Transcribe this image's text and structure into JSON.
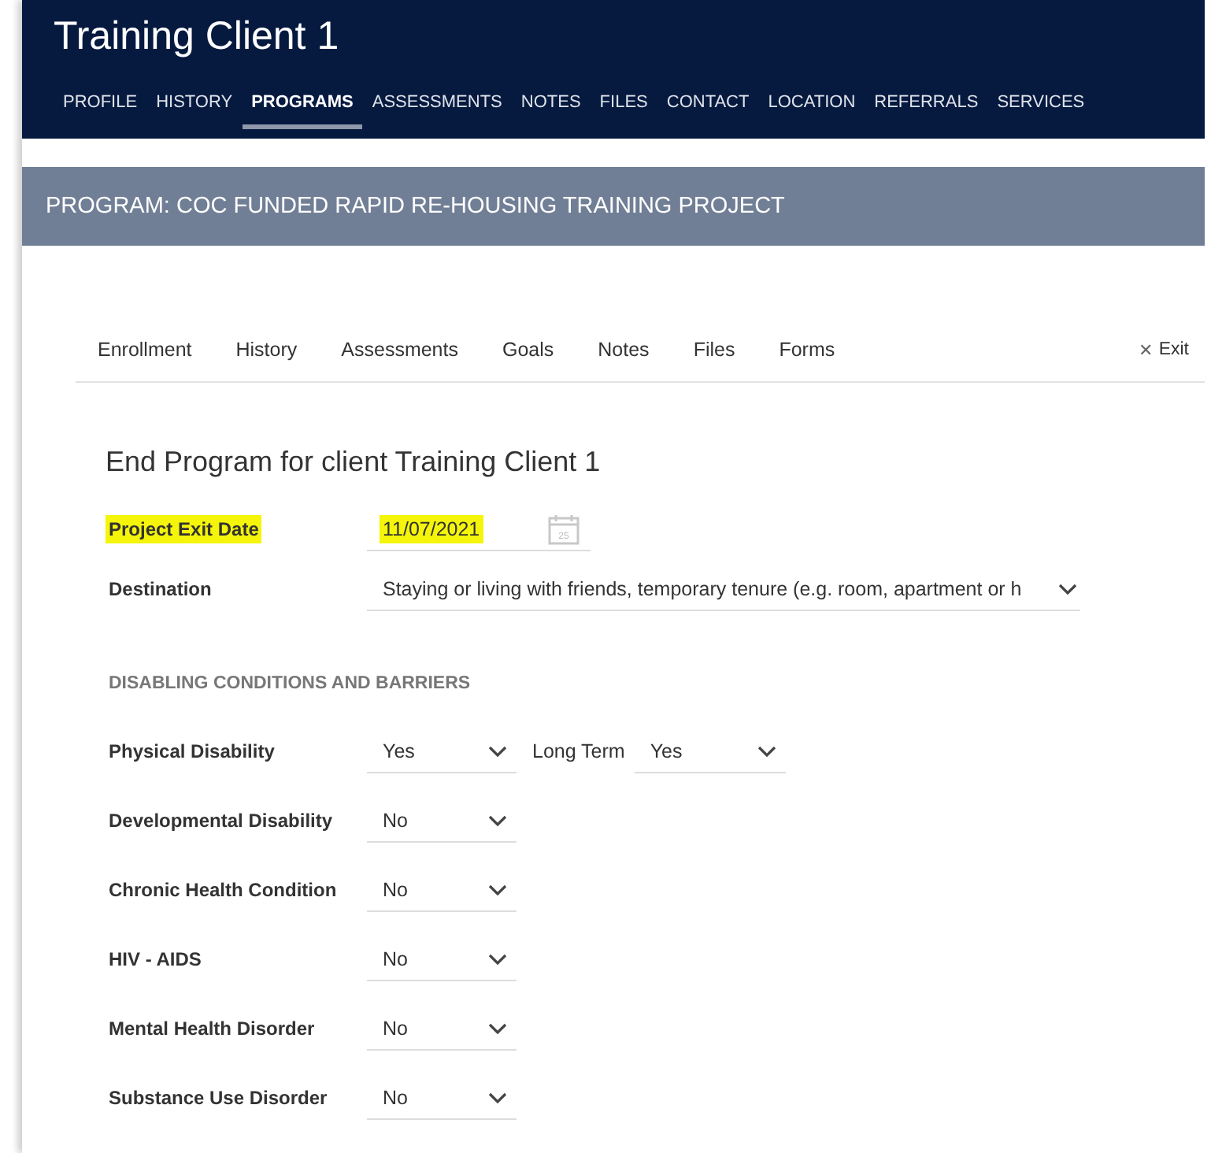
{
  "header": {
    "title": "Training Client 1",
    "tabs": [
      {
        "label": "PROFILE",
        "selected": false
      },
      {
        "label": "HISTORY",
        "selected": false
      },
      {
        "label": "PROGRAMS",
        "selected": true
      },
      {
        "label": "ASSESSMENTS",
        "selected": false
      },
      {
        "label": "NOTES",
        "selected": false
      },
      {
        "label": "FILES",
        "selected": false
      },
      {
        "label": "CONTACT",
        "selected": false
      },
      {
        "label": "LOCATION",
        "selected": false
      },
      {
        "label": "REFERRALS",
        "selected": false
      },
      {
        "label": "SERVICES",
        "selected": false
      }
    ]
  },
  "program_bar": {
    "title": "PROGRAM: COC FUNDED RAPID RE-HOUSING TRAINING PROJECT"
  },
  "sub_tabs": {
    "items": [
      "Enrollment",
      "History",
      "Assessments",
      "Goals",
      "Notes",
      "Files",
      "Forms"
    ],
    "exit": {
      "icon": "✕",
      "label": "Exit"
    }
  },
  "form": {
    "heading": "End Program for client Training Client 1",
    "exit_date": {
      "label": "Project Exit Date",
      "value": "11/07/2021",
      "highlighted": true,
      "calendar_day": "25"
    },
    "destination": {
      "label": "Destination",
      "value": "Staying or living with friends, temporary tenure (e.g. room, apartment or h"
    },
    "section_title": "DISABLING CONDITIONS AND BARRIERS",
    "conditions": [
      {
        "label": "Physical Disability",
        "value": "Yes",
        "extra": {
          "label": "Long Term",
          "value": "Yes"
        }
      },
      {
        "label": "Developmental Disability",
        "value": "No"
      },
      {
        "label": "Chronic Health Condition",
        "value": "No"
      },
      {
        "label": "HIV - AIDS",
        "value": "No"
      },
      {
        "label": "Mental Health Disorder",
        "value": "No"
      },
      {
        "label": "Substance Use Disorder",
        "value": "No"
      }
    ]
  }
}
